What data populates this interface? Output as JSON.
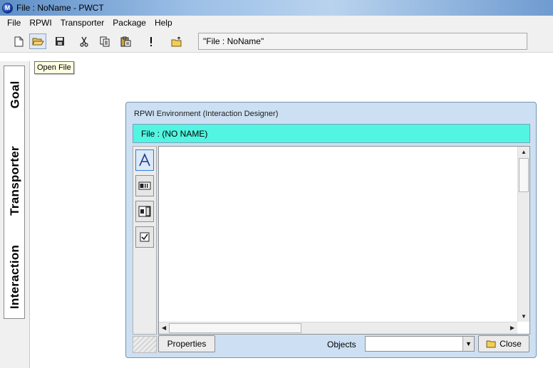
{
  "window": {
    "title": "File : NoName - PWCT",
    "app_icon_letter": "M"
  },
  "menu": [
    "File",
    "RPWI",
    "Transporter",
    "Package",
    "Help"
  ],
  "toolbar": {
    "file_display": "\"File : NoName\"",
    "tooltip": "Open File",
    "icons": [
      "new-file-icon",
      "open-folder-icon",
      "save-icon",
      "cut-icon",
      "copy-icon",
      "paste-icon",
      "exclamation-icon",
      "folder-up-icon"
    ]
  },
  "side_tabs": [
    "Goal",
    "Transporter",
    "Interaction"
  ],
  "dialog": {
    "title": "RPWI Environment (Interaction Designer)",
    "file_label": "File : (NO NAME)",
    "tools": [
      "text-label-tool-icon",
      "textbox-tool-icon",
      "list-tool-icon",
      "checkbox-tool-icon"
    ],
    "properties_label": "Properties",
    "objects_label": "Objects",
    "objects_value": "",
    "close_label": "Close"
  }
}
